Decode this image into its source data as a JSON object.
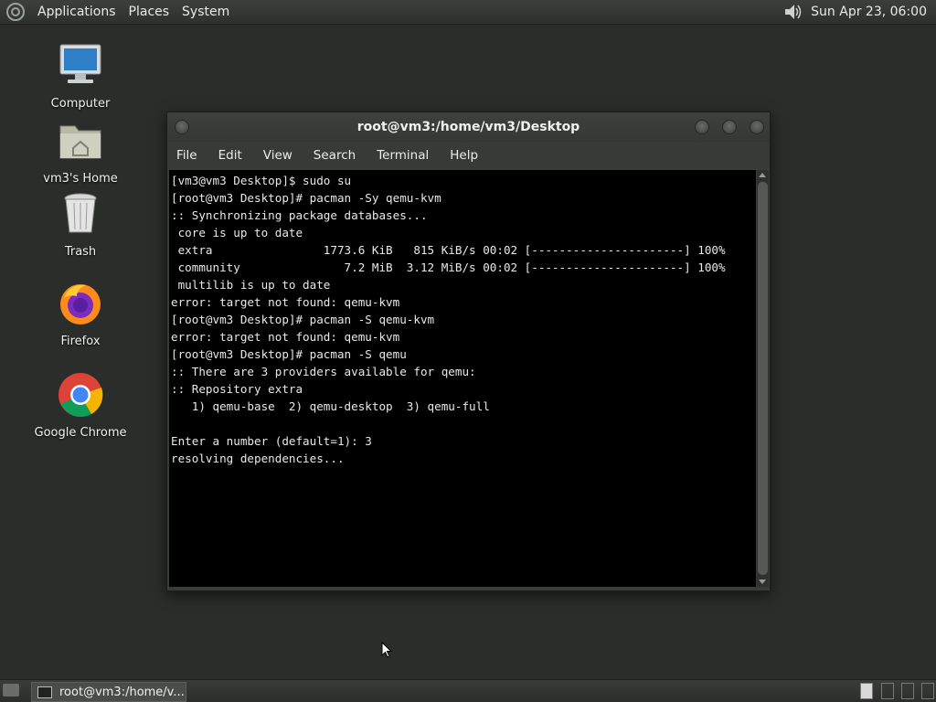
{
  "top_panel": {
    "menus": [
      "Applications",
      "Places",
      "System"
    ],
    "clock": "Sun Apr 23, 06:00",
    "volume_icon": "speaker-icon"
  },
  "desktop_icons": [
    {
      "label": "Computer",
      "icon": "computer-icon"
    },
    {
      "label": "vm3's Home",
      "icon": "home-folder-icon"
    },
    {
      "label": "Trash",
      "icon": "trash-icon"
    },
    {
      "label": "Firefox",
      "icon": "firefox-icon"
    },
    {
      "label": "Google Chrome",
      "icon": "chrome-icon"
    }
  ],
  "terminal": {
    "title": "root@vm3:/home/vm3/Desktop",
    "menu": [
      "File",
      "Edit",
      "View",
      "Search",
      "Terminal",
      "Help"
    ],
    "lines": [
      "[vm3@vm3 Desktop]$ sudo su",
      "[root@vm3 Desktop]# pacman -Sy qemu-kvm",
      ":: Synchronizing package databases...",
      " core is up to date",
      " extra                1773.6 KiB   815 KiB/s 00:02 [----------------------] 100%",
      " community               7.2 MiB  3.12 MiB/s 00:02 [----------------------] 100%",
      " multilib is up to date",
      "error: target not found: qemu-kvm",
      "[root@vm3 Desktop]# pacman -S qemu-kvm",
      "error: target not found: qemu-kvm",
      "[root@vm3 Desktop]# pacman -S qemu",
      ":: There are 3 providers available for qemu:",
      ":: Repository extra",
      "   1) qemu-base  2) qemu-desktop  3) qemu-full",
      "",
      "Enter a number (default=1): 3",
      "resolving dependencies..."
    ]
  },
  "taskbar": {
    "task_label": "root@vm3:/home/v..."
  },
  "colors": {
    "desktop_bg": "#2b2d2b",
    "terminal_bg": "#000000",
    "terminal_fg": "#e8e8e8"
  }
}
